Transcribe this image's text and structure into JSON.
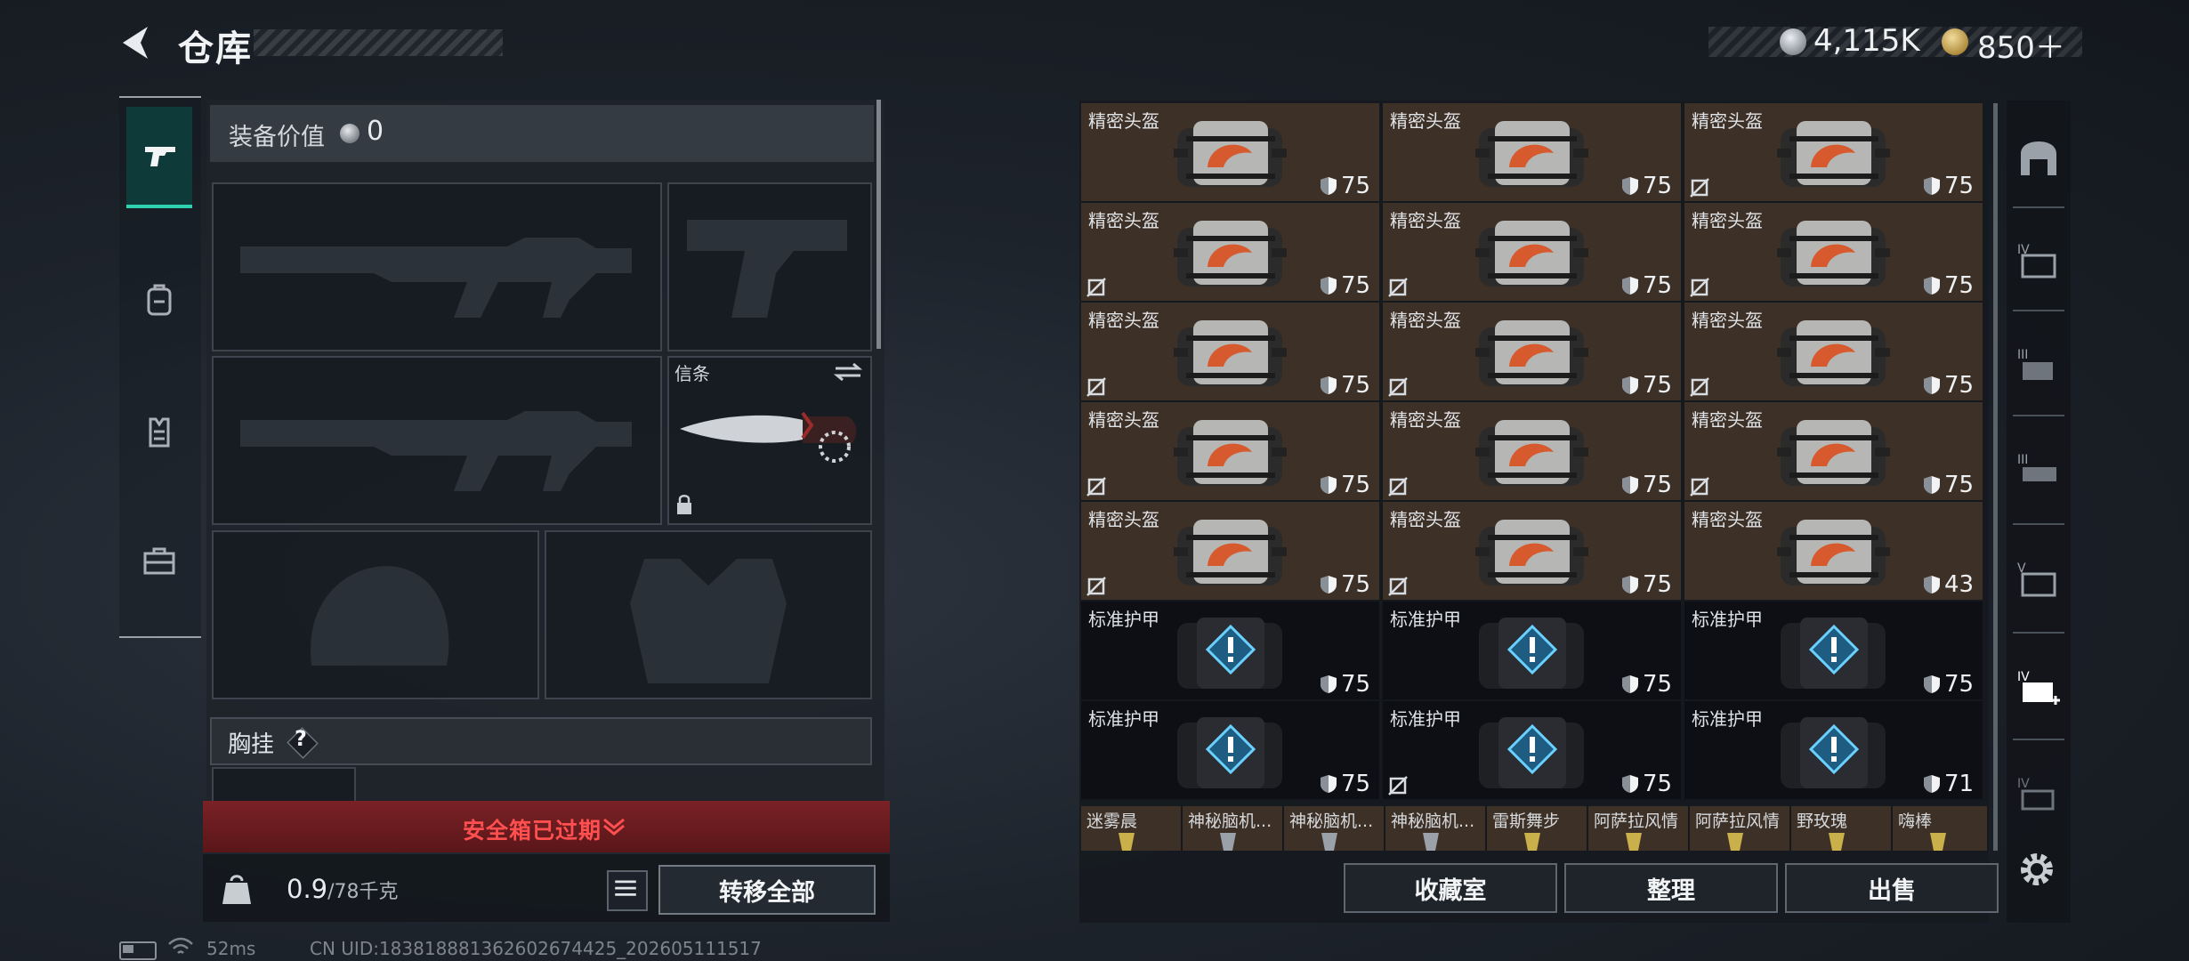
{
  "header": {
    "title": "仓库"
  },
  "currency": {
    "silver": "4,115K",
    "gold": "850＋"
  },
  "rail": [
    "weapon-tab",
    "backpack-tab",
    "armor-vest-tab",
    "toolbox-tab"
  ],
  "equipment": {
    "title": "装备价值",
    "value": "0",
    "knife_label": "信条",
    "chest_rig_label": "胸挂",
    "help": "?"
  },
  "safe_box": {
    "text": "安全箱已过期"
  },
  "footer": {
    "weight": "0.9",
    "weight_capacity": "/78千克",
    "transfer_all": "转移全部"
  },
  "inventory": {
    "helmets": [
      {
        "name": "精密头盔",
        "durability": "75",
        "no_mod": false
      },
      {
        "name": "精密头盔",
        "durability": "75",
        "no_mod": false
      },
      {
        "name": "精密头盔",
        "durability": "75",
        "no_mod": true
      },
      {
        "name": "精密头盔",
        "durability": "75",
        "no_mod": true
      },
      {
        "name": "精密头盔",
        "durability": "75",
        "no_mod": true
      },
      {
        "name": "精密头盔",
        "durability": "75",
        "no_mod": true
      },
      {
        "name": "精密头盔",
        "durability": "75",
        "no_mod": true
      },
      {
        "name": "精密头盔",
        "durability": "75",
        "no_mod": true
      },
      {
        "name": "精密头盔",
        "durability": "75",
        "no_mod": true
      },
      {
        "name": "精密头盔",
        "durability": "75",
        "no_mod": true
      },
      {
        "name": "精密头盔",
        "durability": "75",
        "no_mod": true
      },
      {
        "name": "精密头盔",
        "durability": "75",
        "no_mod": true
      },
      {
        "name": "精密头盔",
        "durability": "75",
        "no_mod": true
      },
      {
        "name": "精密头盔",
        "durability": "75",
        "no_mod": true
      },
      {
        "name": "精密头盔",
        "durability": "43",
        "no_mod": false
      }
    ],
    "armors": [
      {
        "name": "标准护甲",
        "durability": "75",
        "no_mod": false
      },
      {
        "name": "标准护甲",
        "durability": "75",
        "no_mod": false
      },
      {
        "name": "标准护甲",
        "durability": "75",
        "no_mod": false
      },
      {
        "name": "标准护甲",
        "durability": "75",
        "no_mod": false
      },
      {
        "name": "标准护甲",
        "durability": "75",
        "no_mod": true
      },
      {
        "name": "标准护甲",
        "durability": "71",
        "no_mod": false
      }
    ],
    "misc": [
      "迷雾晨",
      "神秘脑机...",
      "神秘脑机...",
      "神秘脑机...",
      "雷斯舞步",
      "阿萨拉风情",
      "阿萨拉风情",
      "野玫瑰",
      "嗨棒"
    ]
  },
  "actions": {
    "collection": "收藏室",
    "sort": "整理",
    "sell": "出售"
  },
  "status": {
    "ping": "52ms",
    "uid": "CN UID:18381888136260267442​5_202605111517"
  }
}
